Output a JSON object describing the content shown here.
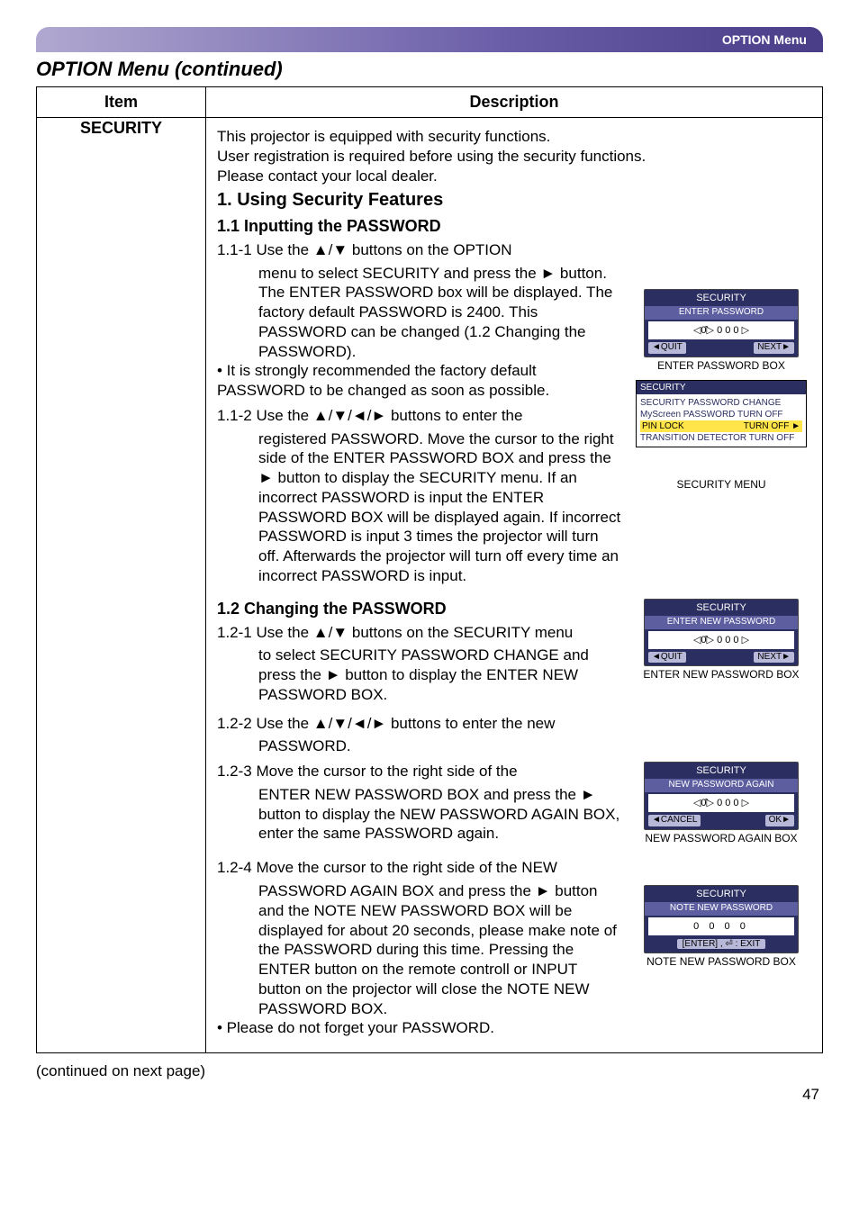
{
  "header": {
    "menu_label": "OPTION Menu"
  },
  "section_title": "OPTION Menu (continued)",
  "table": {
    "col_item": "Item",
    "col_desc": "Description",
    "item_name": "SECURITY",
    "intro": "This projector is equipped with security functions.\nUser registration is required before using the security functions.\nPlease contact your local dealer.",
    "h1": "1. Using Security Features",
    "h11": "1.1 Inputting the PASSWORD",
    "s111a": "1.1-1 Use the ▲/▼ buttons on the OPTION",
    "s111b": "menu to select SECURITY and press the ► button. The ENTER PASSWORD box will be displayed. The factory default PASSWORD is 2400. This PASSWORD can be changed (1.2 Changing the PASSWORD).",
    "s111c": "• It is strongly recommended the factory default PASSWORD to be changed as soon as possible.",
    "s112a": "1.1-2 Use the ▲/▼/◄/► buttons to enter the",
    "s112b": "registered PASSWORD. Move the cursor to the right side of the ENTER PASSWORD BOX and press the ► button to display the SECURITY menu. If an incorrect PASSWORD is input the ENTER PASSWORD BOX will be displayed again. If incorrect PASSWORD is input 3 times the projector will turn off. Afterwards the projector will turn off every time an incorrect PASSWORD is input.",
    "h12": "1.2 Changing the PASSWORD",
    "s121a": "1.2-1 Use the ▲/▼ buttons on the SECURITY menu",
    "s121b": "to select SECURITY PASSWORD CHANGE and press the ► button to display the ENTER NEW PASSWORD BOX.",
    "s122a": "1.2-2 Use the ▲/▼/◄/► buttons to enter the new",
    "s122b": "PASSWORD.",
    "s123a": "1.2-3 Move the cursor to the right side of the",
    "s123b": "ENTER NEW PASSWORD BOX and press the ► button to display the NEW PASSWORD AGAIN BOX, enter the same PASSWORD again.",
    "s124a": "1.2-4 Move the cursor to the right side of the NEW",
    "s124b": "PASSWORD AGAIN BOX and press the ► button and the NOTE NEW PASSWORD BOX will be displayed for about 20 seconds, please make note of the PASSWORD during this time. Pressing the ENTER button on the remote controll or INPUT button on the projector will close the NOTE NEW PASSWORD BOX.",
    "s124c": "• Please do not forget your PASSWORD."
  },
  "osd": {
    "sec_title": "SECURITY",
    "enter_pw": "ENTER PASSWORD",
    "enter_new": "ENTER NEW PASSWORD",
    "new_again": "NEW PASSWORD AGAIN",
    "note_new": "NOTE NEW PASSWORD",
    "digits_zero": "0  0  0  0",
    "quit": "◄QUIT",
    "next": "NEXT►",
    "cancel": "◄CANCEL",
    "ok": "OK►",
    "enter_exit": "[ENTER] , ⏎ : EXIT",
    "cursor0": "◁0̂▷",
    "menu_hdr": "SECURITY",
    "menu_l1": "SECURITY PASSWORD CHANGE",
    "menu_l2": "MyScreen PASSWORD TURN OFF",
    "menu_l3a": "PIN LOCK",
    "menu_l3b": "TURN OFF ►",
    "menu_l4": "TRANSITION DETECTOR TURN OFF",
    "cap_enter": "ENTER PASSWORD BOX",
    "cap_secmenu": "SECURITY MENU",
    "cap_enter_new": "ENTER NEW PASSWORD BOX",
    "cap_again": "NEW PASSWORD AGAIN BOX",
    "cap_note": "NOTE NEW PASSWORD BOX"
  },
  "continued": "(continued on next page)",
  "page_number": "47"
}
